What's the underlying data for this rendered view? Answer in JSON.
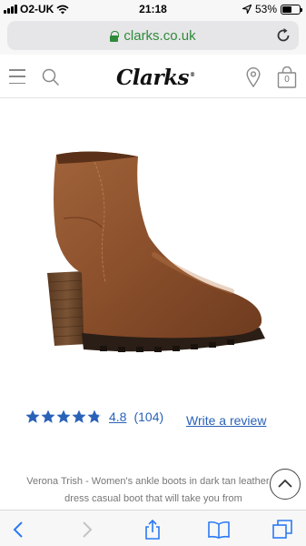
{
  "status_bar": {
    "carrier": "O2-UK",
    "time": "21:18",
    "battery_percent": "53%",
    "battery_level": 0.53,
    "icons": [
      "signal-icon",
      "wifi-icon",
      "location-arrow-icon",
      "battery-icon"
    ]
  },
  "browser": {
    "url": "clarks.co.uk",
    "icons": [
      "lock-icon",
      "reload-icon"
    ]
  },
  "site_header": {
    "logo": "Clarks",
    "logo_mark": "®",
    "bag_count": "0",
    "icons": [
      "menu-icon",
      "search-icon",
      "store-locator-icon",
      "shopping-bag-icon"
    ]
  },
  "product": {
    "image": "brown-ankle-boot",
    "rating_value": "4.8",
    "rating_stars": 4.8,
    "rating_max": 5,
    "review_count": "(104)",
    "write_review": "Write a review",
    "description": "Verona Trish - Women's ankle boots in dark tan leather. A dress casual boot that will take you from"
  },
  "toolbar": {
    "icons": [
      "back-icon",
      "forward-icon",
      "share-icon",
      "bookmarks-icon",
      "tabs-icon"
    ]
  },
  "colors": {
    "link_blue": "#2a62b8",
    "secure_green": "#2e8b3a",
    "star_blue": "#2a62b8"
  }
}
